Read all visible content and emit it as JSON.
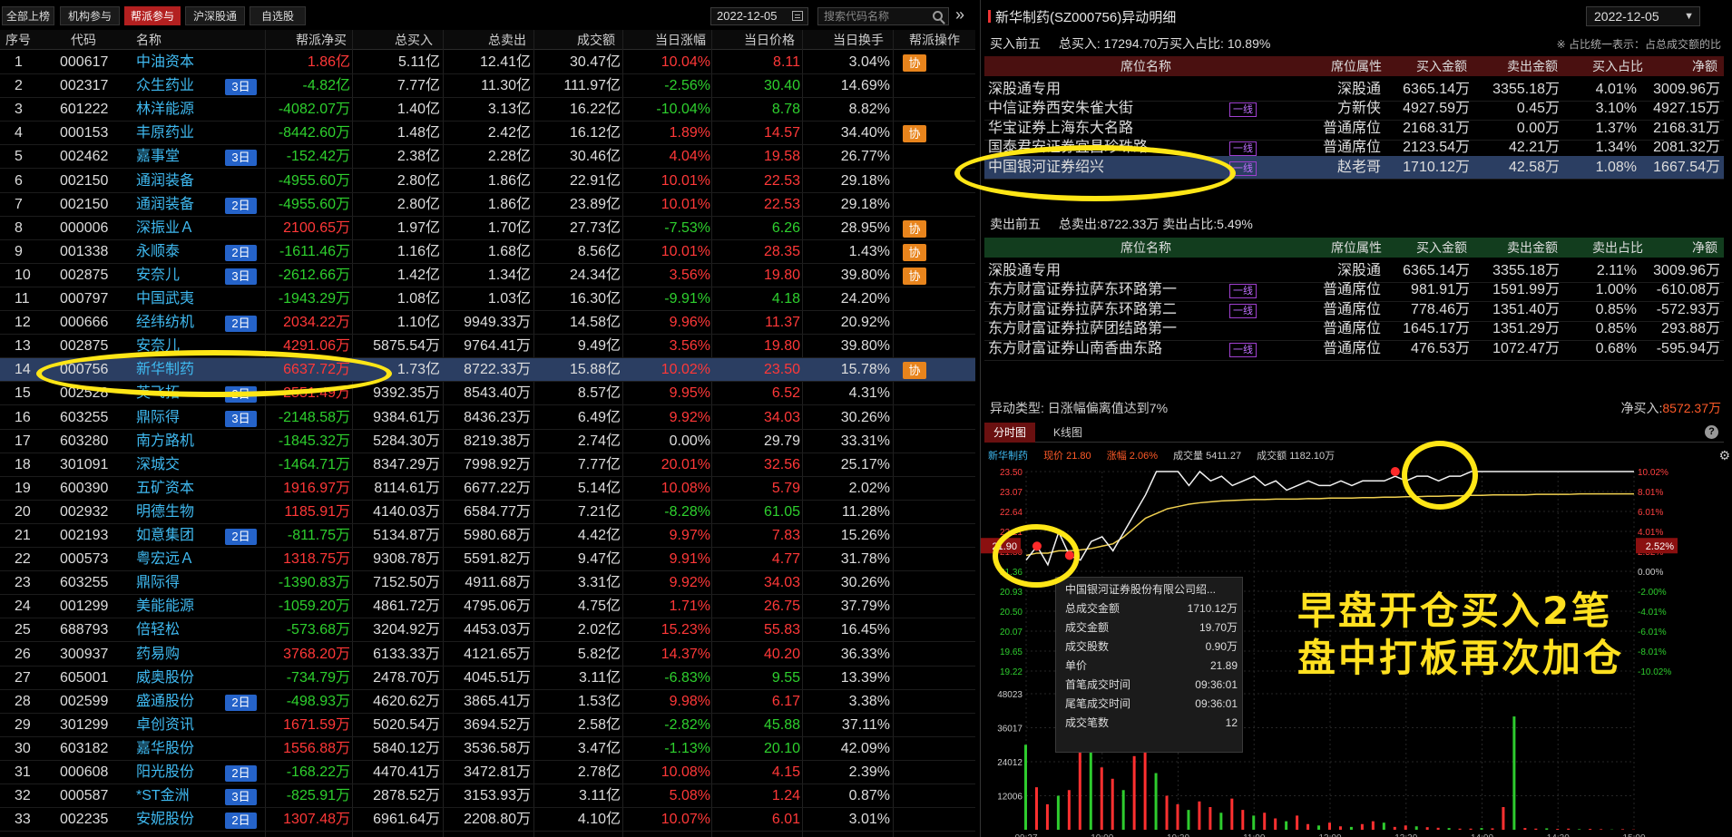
{
  "tabs": [
    "全部上榜",
    "机构参与",
    "帮派参与",
    "沪深股通",
    "自选股"
  ],
  "active_tab": 2,
  "date": "2022-12-05",
  "search_placeholder": "搜索代码名称",
  "columns": [
    "序号",
    "代码",
    "名称",
    "帮派净买",
    "总买入",
    "总卖出",
    "成交额",
    "当日涨幅",
    "当日价格",
    "当日换手",
    "帮派操作"
  ],
  "rows": [
    {
      "idx": "1",
      "code": "000617",
      "name": "中油资本",
      "days": "",
      "net": "1.86亿",
      "net_c": "red",
      "buy": "5.11亿",
      "sell": "12.41亿",
      "vol": "30.47亿",
      "chg": "10.04%",
      "chg_c": "red",
      "price": "8.11",
      "price_c": "red",
      "turn": "3.04%",
      "xie": "协"
    },
    {
      "idx": "2",
      "code": "002317",
      "name": "众生药业",
      "days": "3日",
      "net": "-4.82亿",
      "net_c": "green",
      "buy": "7.77亿",
      "sell": "11.30亿",
      "vol": "111.97亿",
      "chg": "-2.56%",
      "chg_c": "green",
      "price": "30.40",
      "price_c": "green",
      "turn": "14.69%",
      "xie": ""
    },
    {
      "idx": "3",
      "code": "601222",
      "name": "林洋能源",
      "days": "",
      "net": "-4082.07万",
      "net_c": "green",
      "buy": "1.40亿",
      "sell": "3.13亿",
      "vol": "16.22亿",
      "chg": "-10.04%",
      "chg_c": "green",
      "price": "8.78",
      "price_c": "green",
      "turn": "8.82%",
      "xie": ""
    },
    {
      "idx": "4",
      "code": "000153",
      "name": "丰原药业",
      "days": "",
      "net": "-8442.60万",
      "net_c": "green",
      "buy": "1.48亿",
      "sell": "2.42亿",
      "vol": "16.12亿",
      "chg": "1.89%",
      "chg_c": "red",
      "price": "14.57",
      "price_c": "red",
      "turn": "34.40%",
      "xie": "协"
    },
    {
      "idx": "5",
      "code": "002462",
      "name": "嘉事堂",
      "days": "3日",
      "net": "-152.42万",
      "net_c": "green",
      "buy": "2.38亿",
      "sell": "2.28亿",
      "vol": "30.46亿",
      "chg": "4.04%",
      "chg_c": "red",
      "price": "19.58",
      "price_c": "red",
      "turn": "26.77%",
      "xie": ""
    },
    {
      "idx": "6",
      "code": "002150",
      "name": "通润装备",
      "days": "",
      "net": "-4955.60万",
      "net_c": "green",
      "buy": "2.80亿",
      "sell": "1.86亿",
      "vol": "22.91亿",
      "chg": "10.01%",
      "chg_c": "red",
      "price": "22.53",
      "price_c": "red",
      "turn": "29.18%",
      "xie": ""
    },
    {
      "idx": "7",
      "code": "002150",
      "name": "通润装备",
      "days": "2日",
      "net": "-4955.60万",
      "net_c": "green",
      "buy": "2.80亿",
      "sell": "1.86亿",
      "vol": "23.89亿",
      "chg": "10.01%",
      "chg_c": "red",
      "price": "22.53",
      "price_c": "red",
      "turn": "29.18%",
      "xie": ""
    },
    {
      "idx": "8",
      "code": "000006",
      "name": "深振业Ａ",
      "days": "",
      "net": "2100.65万",
      "net_c": "red",
      "buy": "1.97亿",
      "sell": "1.70亿",
      "vol": "27.73亿",
      "chg": "-7.53%",
      "chg_c": "green",
      "price": "6.26",
      "price_c": "green",
      "turn": "28.95%",
      "xie": "协"
    },
    {
      "idx": "9",
      "code": "001338",
      "name": "永顺泰",
      "days": "2日",
      "net": "-1611.46万",
      "net_c": "green",
      "buy": "1.16亿",
      "sell": "1.68亿",
      "vol": "8.56亿",
      "chg": "10.01%",
      "chg_c": "red",
      "price": "28.35",
      "price_c": "red",
      "turn": "1.43%",
      "xie": "协"
    },
    {
      "idx": "10",
      "code": "002875",
      "name": "安奈儿",
      "days": "3日",
      "net": "-2612.66万",
      "net_c": "green",
      "buy": "1.42亿",
      "sell": "1.34亿",
      "vol": "24.34亿",
      "chg": "3.56%",
      "chg_c": "red",
      "price": "19.80",
      "price_c": "red",
      "turn": "39.80%",
      "xie": "协"
    },
    {
      "idx": "11",
      "code": "000797",
      "name": "中国武夷",
      "days": "",
      "net": "-1943.29万",
      "net_c": "green",
      "buy": "1.08亿",
      "sell": "1.03亿",
      "vol": "16.30亿",
      "chg": "-9.91%",
      "chg_c": "green",
      "price": "4.18",
      "price_c": "green",
      "turn": "24.20%",
      "xie": ""
    },
    {
      "idx": "12",
      "code": "000666",
      "name": "经纬纺机",
      "days": "2日",
      "net": "2034.22万",
      "net_c": "red",
      "buy": "1.10亿",
      "sell": "9949.33万",
      "vol": "14.58亿",
      "chg": "9.96%",
      "chg_c": "red",
      "price": "11.37",
      "price_c": "red",
      "turn": "20.92%",
      "xie": ""
    },
    {
      "idx": "13",
      "code": "002875",
      "name": "安奈儿",
      "days": "",
      "net": "4291.06万",
      "net_c": "red",
      "buy": "5875.54万",
      "sell": "9764.41万",
      "vol": "9.49亿",
      "chg": "3.56%",
      "chg_c": "red",
      "price": "19.80",
      "price_c": "red",
      "turn": "39.80%",
      "xie": ""
    },
    {
      "idx": "14",
      "code": "000756",
      "name": "新华制药",
      "days": "",
      "net": "6637.72万",
      "net_c": "red",
      "buy": "1.73亿",
      "sell": "8722.33万",
      "vol": "15.88亿",
      "chg": "10.02%",
      "chg_c": "red",
      "price": "23.50",
      "price_c": "red",
      "turn": "15.78%",
      "xie": "协"
    },
    {
      "idx": "15",
      "code": "002528",
      "name": "英飞拓",
      "days": "2日",
      "net": "2551.49万",
      "net_c": "red",
      "buy": "9392.35万",
      "sell": "8543.40万",
      "vol": "8.57亿",
      "chg": "9.95%",
      "chg_c": "red",
      "price": "6.52",
      "price_c": "red",
      "turn": "4.31%",
      "xie": ""
    },
    {
      "idx": "16",
      "code": "603255",
      "name": "鼎际得",
      "days": "3日",
      "net": "-2148.58万",
      "net_c": "green",
      "buy": "9384.61万",
      "sell": "8436.23万",
      "vol": "6.49亿",
      "chg": "9.92%",
      "chg_c": "red",
      "price": "34.03",
      "price_c": "red",
      "turn": "30.26%",
      "xie": ""
    },
    {
      "idx": "17",
      "code": "603280",
      "name": "南方路机",
      "days": "",
      "net": "-1845.32万",
      "net_c": "green",
      "buy": "5284.30万",
      "sell": "8219.38万",
      "vol": "2.74亿",
      "chg": "0.00%",
      "chg_c": "white",
      "price": "29.79",
      "price_c": "white",
      "turn": "33.31%",
      "xie": ""
    },
    {
      "idx": "18",
      "code": "301091",
      "name": "深城交",
      "days": "",
      "net": "-1464.71万",
      "net_c": "green",
      "buy": "8347.29万",
      "sell": "7998.92万",
      "vol": "7.77亿",
      "chg": "20.01%",
      "chg_c": "red",
      "price": "32.56",
      "price_c": "red",
      "turn": "25.17%",
      "xie": ""
    },
    {
      "idx": "19",
      "code": "600390",
      "name": "五矿资本",
      "days": "",
      "net": "1916.97万",
      "net_c": "red",
      "buy": "8114.61万",
      "sell": "6677.22万",
      "vol": "5.14亿",
      "chg": "10.08%",
      "chg_c": "red",
      "price": "5.79",
      "price_c": "red",
      "turn": "2.02%",
      "xie": ""
    },
    {
      "idx": "20",
      "code": "002932",
      "name": "明德生物",
      "days": "",
      "net": "1185.91万",
      "net_c": "red",
      "buy": "4140.03万",
      "sell": "6584.77万",
      "vol": "7.21亿",
      "chg": "-8.28%",
      "chg_c": "green",
      "price": "61.05",
      "price_c": "green",
      "turn": "11.28%",
      "xie": ""
    },
    {
      "idx": "21",
      "code": "002193",
      "name": "如意集团",
      "days": "2日",
      "net": "-811.75万",
      "net_c": "green",
      "buy": "5134.87万",
      "sell": "5980.68万",
      "vol": "4.42亿",
      "chg": "9.97%",
      "chg_c": "red",
      "price": "7.83",
      "price_c": "red",
      "turn": "15.26%",
      "xie": ""
    },
    {
      "idx": "22",
      "code": "000573",
      "name": "粤宏远Ａ",
      "days": "",
      "net": "1318.75万",
      "net_c": "red",
      "buy": "9308.78万",
      "sell": "5591.82万",
      "vol": "9.47亿",
      "chg": "9.91%",
      "chg_c": "red",
      "price": "4.77",
      "price_c": "red",
      "turn": "31.78%",
      "xie": ""
    },
    {
      "idx": "23",
      "code": "603255",
      "name": "鼎际得",
      "days": "",
      "net": "-1390.83万",
      "net_c": "green",
      "buy": "7152.50万",
      "sell": "4911.68万",
      "vol": "3.31亿",
      "chg": "9.92%",
      "chg_c": "red",
      "price": "34.03",
      "price_c": "red",
      "turn": "30.26%",
      "xie": ""
    },
    {
      "idx": "24",
      "code": "001299",
      "name": "美能能源",
      "days": "",
      "net": "-1059.20万",
      "net_c": "green",
      "buy": "4861.72万",
      "sell": "4795.06万",
      "vol": "4.75亿",
      "chg": "1.71%",
      "chg_c": "red",
      "price": "26.75",
      "price_c": "red",
      "turn": "37.79%",
      "xie": ""
    },
    {
      "idx": "25",
      "code": "688793",
      "name": "倍轻松",
      "days": "",
      "net": "-573.68万",
      "net_c": "green",
      "buy": "3204.92万",
      "sell": "4453.03万",
      "vol": "2.02亿",
      "chg": "15.23%",
      "chg_c": "red",
      "price": "55.83",
      "price_c": "red",
      "turn": "16.45%",
      "xie": ""
    },
    {
      "idx": "26",
      "code": "300937",
      "name": "药易购",
      "days": "",
      "net": "3768.20万",
      "net_c": "red",
      "buy": "6133.33万",
      "sell": "4121.65万",
      "vol": "5.82亿",
      "chg": "14.37%",
      "chg_c": "red",
      "price": "40.20",
      "price_c": "red",
      "turn": "36.33%",
      "xie": ""
    },
    {
      "idx": "27",
      "code": "605001",
      "name": "威奥股份",
      "days": "",
      "net": "-734.79万",
      "net_c": "green",
      "buy": "2478.70万",
      "sell": "4045.51万",
      "vol": "3.11亿",
      "chg": "-6.83%",
      "chg_c": "green",
      "price": "9.55",
      "price_c": "green",
      "turn": "13.39%",
      "xie": ""
    },
    {
      "idx": "28",
      "code": "002599",
      "name": "盛通股份",
      "days": "2日",
      "net": "-498.93万",
      "net_c": "green",
      "buy": "4620.62万",
      "sell": "3865.41万",
      "vol": "1.53亿",
      "chg": "9.98%",
      "chg_c": "red",
      "price": "6.17",
      "price_c": "red",
      "turn": "3.38%",
      "xie": ""
    },
    {
      "idx": "29",
      "code": "301299",
      "name": "卓创资讯",
      "days": "",
      "net": "1671.59万",
      "net_c": "red",
      "buy": "5020.54万",
      "sell": "3694.52万",
      "vol": "2.58亿",
      "chg": "-2.82%",
      "chg_c": "green",
      "price": "45.88",
      "price_c": "green",
      "turn": "37.11%",
      "xie": ""
    },
    {
      "idx": "30",
      "code": "603182",
      "name": "嘉华股份",
      "days": "",
      "net": "1556.88万",
      "net_c": "red",
      "buy": "5840.12万",
      "sell": "3536.58万",
      "vol": "3.47亿",
      "chg": "-1.13%",
      "chg_c": "green",
      "price": "20.10",
      "price_c": "green",
      "turn": "42.09%",
      "xie": ""
    },
    {
      "idx": "31",
      "code": "000608",
      "name": "阳光股份",
      "days": "2日",
      "net": "-168.22万",
      "net_c": "green",
      "buy": "4470.41万",
      "sell": "3472.81万",
      "vol": "2.78亿",
      "chg": "10.08%",
      "chg_c": "red",
      "price": "4.15",
      "price_c": "red",
      "turn": "2.39%",
      "xie": ""
    },
    {
      "idx": "32",
      "code": "000587",
      "name": "*ST金洲",
      "days": "3日",
      "net": "-825.91万",
      "net_c": "green",
      "buy": "2878.52万",
      "sell": "3153.93万",
      "vol": "3.11亿",
      "chg": "5.08%",
      "chg_c": "red",
      "price": "1.24",
      "price_c": "red",
      "turn": "0.87%",
      "xie": ""
    },
    {
      "idx": "33",
      "code": "002235",
      "name": "安妮股份",
      "days": "2日",
      "net": "1307.48万",
      "net_c": "red",
      "buy": "6961.64万",
      "sell": "2208.80万",
      "vol": "4.10亿",
      "chg": "10.07%",
      "chg_c": "red",
      "price": "6.01",
      "price_c": "red",
      "turn": "3.01%",
      "xie": ""
    }
  ],
  "selected_row": 13,
  "detail": {
    "title": "新华制药(SZ000756)异动明细",
    "date": "2022-12-05",
    "buy_header": "买入前五",
    "buy_total": "总买入: 17294.70万买入占比: 10.89%",
    "hint": "※ 占比统一表示：占总成交额的比",
    "buy_cols": [
      "席位名称",
      "席位属性",
      "买入金额",
      "卖出金额",
      "买入占比",
      "净额"
    ],
    "buy_rows": [
      {
        "name": "深股通专用",
        "tag": "",
        "attr": "深股通",
        "b": "6365.14万",
        "s": "3355.18万",
        "p": "4.01%",
        "n": "3009.96万"
      },
      {
        "name": "中信证券西安朱雀大街",
        "tag": "一线",
        "attr": "方新侠",
        "b": "4927.59万",
        "s": "0.45万",
        "p": "3.10%",
        "n": "4927.15万"
      },
      {
        "name": "华宝证券上海东大名路",
        "tag": "",
        "attr": "普通席位",
        "b": "2168.31万",
        "s": "0.00万",
        "p": "1.37%",
        "n": "2168.31万"
      },
      {
        "name": "国泰君安证券宜昌珍珠路",
        "tag": "一线",
        "attr": "普通席位",
        "b": "2123.54万",
        "s": "42.21万",
        "p": "1.34%",
        "n": "2081.32万"
      },
      {
        "name": "中国银河证券绍兴",
        "tag": "一线",
        "attr": "赵老哥",
        "b": "1710.12万",
        "s": "42.58万",
        "p": "1.08%",
        "n": "1667.54万"
      }
    ],
    "buy_selected": 4,
    "sell_header": "卖出前五",
    "sell_total": "总卖出:8722.33万   卖出占比:5.49%",
    "sell_cols": [
      "席位名称",
      "席位属性",
      "买入金额",
      "卖出金额",
      "卖出占比",
      "净额"
    ],
    "sell_rows": [
      {
        "name": "深股通专用",
        "tag": "",
        "attr": "深股通",
        "b": "6365.14万",
        "s": "3355.18万",
        "p": "2.11%",
        "n": "3009.96万"
      },
      {
        "name": "东方财富证券拉萨东环路第一",
        "tag": "一线",
        "attr": "普通席位",
        "b": "981.91万",
        "s": "1591.99万",
        "p": "1.00%",
        "n": "-610.08万"
      },
      {
        "name": "东方财富证券拉萨东环路第二",
        "tag": "一线",
        "attr": "普通席位",
        "b": "778.46万",
        "s": "1351.40万",
        "p": "0.85%",
        "n": "-572.93万"
      },
      {
        "name": "东方财富证券拉萨团结路第一",
        "tag": "",
        "attr": "普通席位",
        "b": "1645.17万",
        "s": "1351.29万",
        "p": "0.85%",
        "n": "293.88万"
      },
      {
        "name": "东方财富证券山南香曲东路",
        "tag": "一线",
        "attr": "普通席位",
        "b": "476.53万",
        "s": "1072.47万",
        "p": "0.68%",
        "n": "-595.94万"
      }
    ],
    "anomaly": "异动类型: 日涨幅偏离值达到7%",
    "netbuy_label": "净买入:",
    "netbuy_value": "8572.37万",
    "chart_tabs": [
      "分时图",
      "K线图"
    ],
    "info": {
      "name": "新华制药",
      "price_label": "现价",
      "price": "21.80",
      "chg_label": "涨幅",
      "chg": "2.06%",
      "vol_label": "成交量",
      "vol": "5411.27",
      "amt_label": "成交额",
      "amt": "1182.10万"
    },
    "tooltip": {
      "title": "中国银河证券股份有限公司绍...",
      "rows": [
        {
          "k": "总成交金额",
          "v": "1710.12万"
        },
        {
          "k": "成交金额",
          "v": "19.70万"
        },
        {
          "k": "成交股数",
          "v": "0.90万"
        },
        {
          "k": "单价",
          "v": "21.89"
        },
        {
          "k": "首笔成交时间",
          "v": "09:36:01"
        },
        {
          "k": "尾笔成交时间",
          "v": "09:36:01"
        },
        {
          "k": "成交笔数",
          "v": "12"
        }
      ]
    },
    "annotation": [
      "早盘开仓买入2笔",
      "盘中打板再次加仓"
    ]
  },
  "chart_data": {
    "type": "line",
    "price_ticks": [
      "23.50",
      "23.07",
      "22.64",
      "22.21",
      "21.80",
      "21.36",
      "20.93",
      "20.50",
      "20.07",
      "19.65",
      "19.22"
    ],
    "pct_ticks": [
      "10.02%",
      "8.01%",
      "6.01%",
      "4.01%",
      "2.52%",
      "0.00%",
      "-2.00%",
      "-4.01%",
      "-6.01%",
      "-8.01%",
      "-10.02%"
    ],
    "current_price_label": "21.90",
    "current_pct_label": "2.52%",
    "vol_ticks": [
      "48023",
      "36017",
      "24012",
      "12006"
    ],
    "time_ticks": [
      "09:27",
      "10:00",
      "10:30",
      "11:00",
      "13:00",
      "13:30",
      "14:00",
      "14:30",
      "15:00"
    ],
    "price_series": [
      21.6,
      21.9,
      21.5,
      22.2,
      21.7,
      21.6,
      22.0,
      22.1,
      21.8,
      22.2,
      22.6,
      23.0,
      23.5,
      23.5,
      23.5,
      23.2,
      23.5,
      23.3,
      23.4,
      23.2,
      23.3,
      23.4,
      23.2,
      23.3,
      23.1,
      23.2,
      23.3,
      23.2,
      23.2,
      23.3,
      23.2,
      23.3,
      23.3,
      23.3,
      23.4,
      23.3,
      23.4,
      23.4,
      23.3,
      23.4,
      23.4,
      23.5,
      23.5,
      23.5,
      23.5,
      23.5,
      23.5,
      23.5,
      23.5,
      23.5,
      23.5,
      23.5,
      23.5,
      23.5,
      23.5,
      23.5,
      23.5
    ],
    "avg_series": [
      21.7,
      21.75,
      21.75,
      21.8,
      21.8,
      21.82,
      21.85,
      21.9,
      21.95,
      22.1,
      22.3,
      22.5,
      22.6,
      22.7,
      22.75,
      22.8,
      22.83,
      22.85,
      22.87,
      22.88,
      22.89,
      22.9,
      22.9,
      22.91,
      22.91,
      22.91,
      22.92,
      22.92,
      22.93,
      22.93,
      22.93,
      22.94,
      22.94,
      22.95,
      22.95,
      22.96,
      22.96,
      22.97,
      22.97,
      22.98,
      22.98,
      22.99,
      22.99,
      23.0,
      23.0,
      23.0,
      23.0,
      23.01,
      23.01,
      23.01,
      23.01,
      23.02,
      23.02,
      23.02,
      23.02,
      23.02,
      23.02
    ],
    "volume_series": [
      30000,
      15000,
      9000,
      12000,
      14000,
      40000,
      48000,
      22000,
      18000,
      14000,
      26000,
      30000,
      20000,
      12000,
      9000,
      7000,
      10000,
      8000,
      6000,
      11000,
      7000,
      5000,
      6000,
      4000,
      3000,
      5000,
      2000,
      1500,
      2500,
      1200,
      1000,
      2000,
      3000,
      2500,
      1000,
      1500,
      1200,
      900,
      700,
      600,
      400,
      400,
      600,
      500,
      8000,
      40000,
      600,
      400,
      500,
      300,
      400,
      200,
      300,
      200,
      100,
      200,
      100
    ],
    "markers": [
      {
        "x": 1,
        "y": 21.9
      },
      {
        "x": 4,
        "y": 21.7
      },
      {
        "x": 34,
        "y": 23.5
      }
    ],
    "ylim": [
      19.22,
      23.5
    ]
  }
}
